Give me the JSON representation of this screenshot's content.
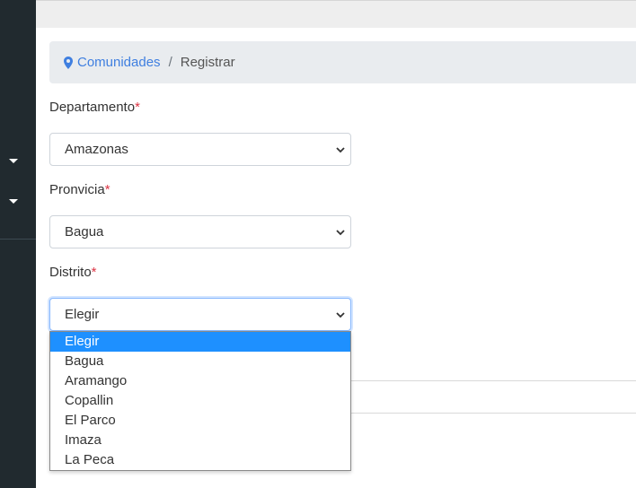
{
  "breadcrumb": {
    "link": "Comunidades",
    "separator": "/",
    "current": "Registrar"
  },
  "form": {
    "departamento": {
      "label": "Departamento",
      "required_mark": "*",
      "value": "Amazonas"
    },
    "provincia": {
      "label": "Pronvicia",
      "required_mark": "*",
      "value": "Bagua"
    },
    "distrito": {
      "label": "Distrito",
      "required_mark": "*",
      "value": "Elegir"
    }
  },
  "distrito_options": [
    "Elegir",
    "Bagua",
    "Aramango",
    "Copallin",
    "El Parco",
    "Imaza",
    "La Peca"
  ],
  "colors": {
    "accent": "#3f7fe0",
    "sidebar": "#212a2f",
    "required": "#dc3545",
    "highlight": "#1e90ff"
  }
}
